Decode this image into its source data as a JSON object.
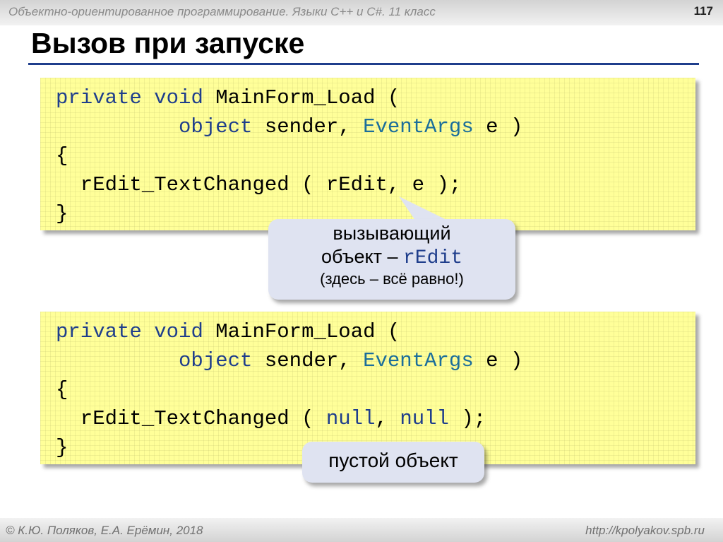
{
  "header": {
    "course": "Объектно-ориентированное программирование. Языки C++ и C#. 11 класс",
    "slide_number": "117"
  },
  "title": "Вызов при запуске",
  "code_block_1": {
    "l1_kw1": "private",
    "l1_kw2": "void",
    "l1_rest": " MainForm_Load (",
    "l2_kw": "object",
    "l2_mid": " sender, ",
    "l2_cls": "EventArgs",
    "l2_end": " e )",
    "l3": "{",
    "l4": "  rEdit_TextChanged ( rEdit, e );",
    "l5": "}"
  },
  "callout_1": {
    "line1": "вызывающий",
    "line2_text": "объект – ",
    "line2_code": "rEdit",
    "line3": "(здесь – всё равно!)"
  },
  "code_block_2": {
    "l1_kw1": "private",
    "l1_kw2": "void",
    "l1_rest": " MainForm_Load (",
    "l2_kw": "object",
    "l2_mid": " sender, ",
    "l2_cls": "EventArgs",
    "l2_end": " e )",
    "l3": "{",
    "l4_start": "  rEdit_TextChanged ( ",
    "l4_null1": "null",
    "l4_sep": ", ",
    "l4_null2": "null",
    "l4_end": " );",
    "l5": "}"
  },
  "callout_2": {
    "text": "пустой объект"
  },
  "footer": {
    "left": "© К.Ю. Поляков, Е.А. Ерёмин, 2018",
    "right": "http://kpolyakov.spb.ru"
  },
  "colors": {
    "code_background": "#ffff99",
    "keyword": "#1f3e8c",
    "class_name": "#1b6e9b",
    "callout_background": "#dfe3f1",
    "title_rule": "#1f3e8c"
  }
}
